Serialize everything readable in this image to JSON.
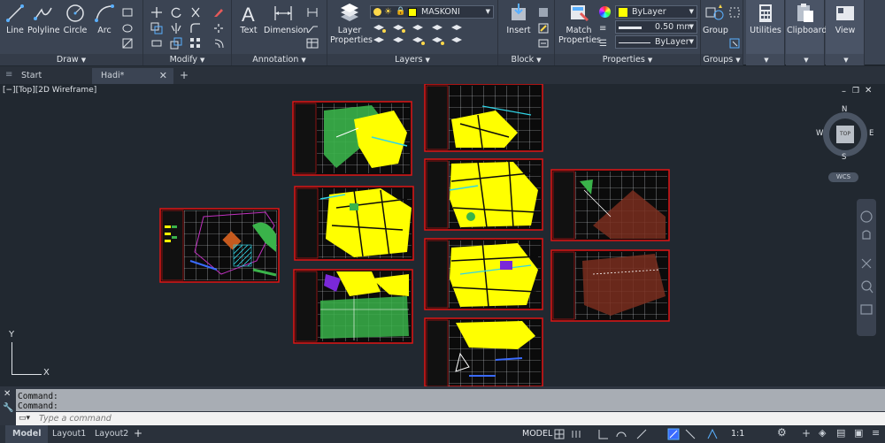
{
  "ribbon": {
    "draw": {
      "title": "Draw",
      "line": "Line",
      "polyline": "Polyline",
      "circle": "Circle",
      "arc": "Arc"
    },
    "modify": {
      "title": "Modify"
    },
    "annotation": {
      "title": "Annotation",
      "text": "Text",
      "dimension": "Dimension"
    },
    "layers": {
      "title": "Layers",
      "layer_properties": "Layer Properties",
      "current_layer": "MASKONI"
    },
    "block": {
      "title": "Block",
      "insert": "Insert"
    },
    "properties": {
      "title": "Properties",
      "match_properties": "Match Properties",
      "color": "ByLayer",
      "lineweight": "0.50 mm",
      "linetype": "ByLayer"
    },
    "groups": {
      "title": "Groups",
      "group": "Group"
    },
    "utilities": {
      "title": "Utilities"
    },
    "clipboard": {
      "title": "Clipboard"
    },
    "view": {
      "title": "View"
    }
  },
  "file_tabs": [
    {
      "label": "Start"
    },
    {
      "label": "Hadi*"
    }
  ],
  "viewport": {
    "label": "[−][Top][2D Wireframe]",
    "viewcube": {
      "n": "N",
      "s": "S",
      "e": "E",
      "w": "W",
      "face": "TOP",
      "wcs": "WCS"
    },
    "ucs": {
      "x": "X",
      "y": "Y"
    }
  },
  "command": {
    "history": [
      "Command:",
      "Command:"
    ],
    "placeholder": "Type a command"
  },
  "layout_tabs": [
    {
      "label": "Model"
    },
    {
      "label": "Layout1"
    },
    {
      "label": "Layout2"
    }
  ],
  "status": {
    "mode": "MODEL",
    "scale": "1:1"
  },
  "colors": {
    "ribbon": "#3b4453",
    "canvas": "#212830",
    "sheet_border": "#e01515",
    "parcel": "#ffff00",
    "green": "#3ab34a"
  }
}
